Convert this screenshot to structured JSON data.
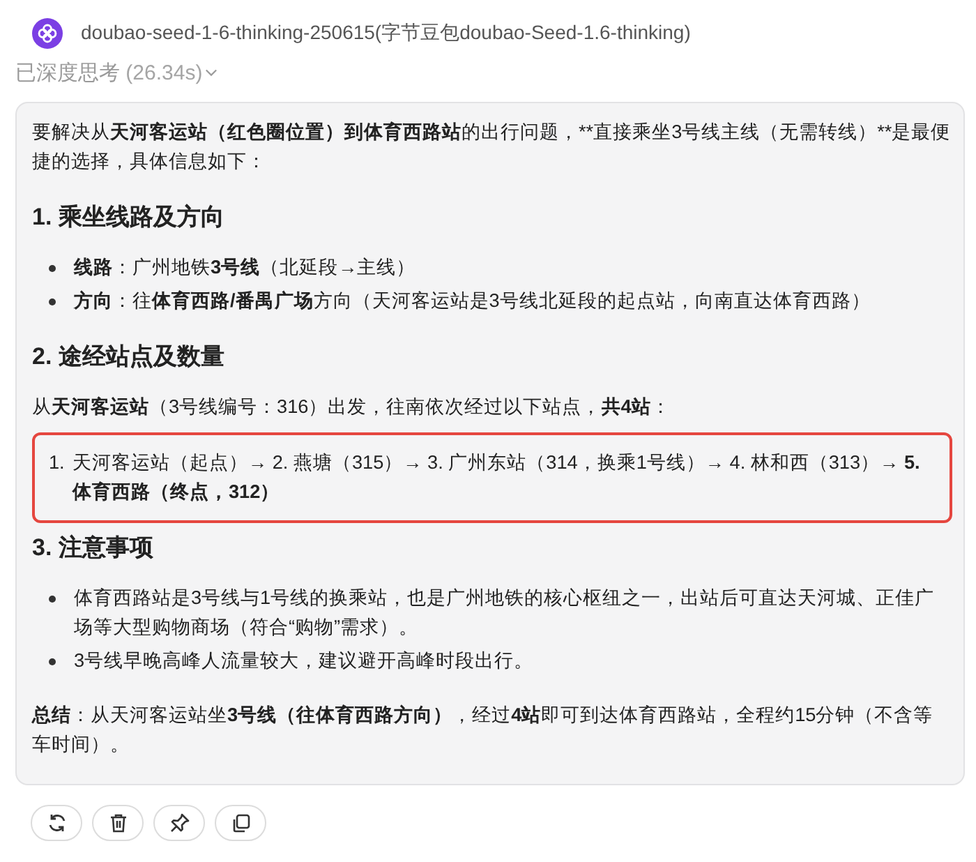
{
  "header": {
    "model_name": "doubao-seed-1-6-thinking-250615(字节豆包doubao-Seed-1.6-thinking)",
    "thinking_label": "已深度思考",
    "thinking_time": "(26.34s)"
  },
  "answer": {
    "blocks": [
      {
        "kind": "paragraph",
        "segments": [
          {
            "text": "要解决从",
            "bold": false
          },
          {
            "text": "天河客运站（红色圈位置）到体育西路站",
            "bold": true
          },
          {
            "text": "的出行问题，**直接乘坐3号线主线（无需转线）**是最便捷的选择，具体信息如下：",
            "bold": false
          }
        ]
      },
      {
        "kind": "heading",
        "text": "1. 乘坐线路及方向"
      },
      {
        "kind": "bullets",
        "items": [
          [
            {
              "text": "线路",
              "bold": true
            },
            {
              "text": "：广州地铁",
              "bold": false
            },
            {
              "text": "3号线",
              "bold": true
            },
            {
              "text": "（北延段→主线）",
              "bold": false
            }
          ],
          [
            {
              "text": "方向",
              "bold": true
            },
            {
              "text": "：往",
              "bold": false
            },
            {
              "text": "体育西路/番禺广场",
              "bold": true
            },
            {
              "text": "方向（天河客运站是3号线北延段的起点站，向南直达体育西路）",
              "bold": false
            }
          ]
        ]
      },
      {
        "kind": "heading",
        "text": "2. 途经站点及数量"
      },
      {
        "kind": "paragraph",
        "segments": [
          {
            "text": "从",
            "bold": false
          },
          {
            "text": "天河客运站",
            "bold": true
          },
          {
            "text": "（3号线编号：316）出发，往南依次经过以下站点，",
            "bold": false
          },
          {
            "text": "共4站",
            "bold": true
          },
          {
            "text": "：",
            "bold": false
          }
        ]
      },
      {
        "kind": "highlight_list",
        "items": [
          {
            "marker": "1.",
            "segments": [
              {
                "text": "天河客运站（起点）→ 2. 燕塘（315）→ 3. 广州东站（314，换乘1号线）→ 4. 林和西（313）→ ",
                "bold": false
              },
              {
                "text": "5. 体育西路（终点，312）",
                "bold": true
              }
            ]
          }
        ]
      },
      {
        "kind": "heading",
        "text": "3. 注意事项"
      },
      {
        "kind": "bullets",
        "items": [
          [
            {
              "text": "体育西路站是3号线与1号线的换乘站，也是广州地铁的核心枢纽之一，出站后可直达天河城、正佳广场等大型购物商场（符合“购物”需求）。",
              "bold": false
            }
          ],
          [
            {
              "text": "3号线早晚高峰人流量较大，建议避开高峰时段出行。",
              "bold": false
            }
          ]
        ]
      },
      {
        "kind": "paragraph",
        "segments": [
          {
            "text": "总结",
            "bold": true
          },
          {
            "text": "：从天河客运站坐",
            "bold": false
          },
          {
            "text": "3号线（往体育西路方向）",
            "bold": true
          },
          {
            "text": "，经过",
            "bold": false
          },
          {
            "text": "4站",
            "bold": true
          },
          {
            "text": "即可到达体育西路站，全程约15分钟（不含等车时间）。",
            "bold": false
          }
        ]
      }
    ]
  },
  "actions": [
    {
      "kind": "refresh"
    },
    {
      "kind": "delete"
    },
    {
      "kind": "pin"
    },
    {
      "kind": "copy"
    }
  ]
}
